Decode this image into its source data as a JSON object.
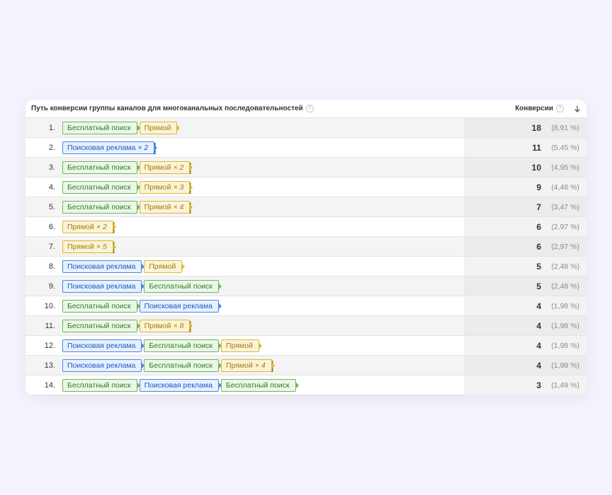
{
  "header": {
    "path_label": "Путь конверсии группы каналов для многоканальных последовательностей",
    "conversions_label": "Конверсии"
  },
  "channel_colors": {
    "Бесплатный поиск": "green",
    "Прямой": "yellow",
    "Поисковая реклама": "blue"
  },
  "rows": [
    {
      "n": 1,
      "path": [
        {
          "c": "Бесплатный поиск"
        },
        {
          "c": "Прямой"
        }
      ],
      "v": "18",
      "p": "(8,91 %)"
    },
    {
      "n": 2,
      "path": [
        {
          "c": "Поисковая реклама",
          "x": 2
        }
      ],
      "v": "11",
      "p": "(5,45 %)"
    },
    {
      "n": 3,
      "path": [
        {
          "c": "Бесплатный поиск"
        },
        {
          "c": "Прямой",
          "x": 2
        }
      ],
      "v": "10",
      "p": "(4,95 %)"
    },
    {
      "n": 4,
      "path": [
        {
          "c": "Бесплатный поиск"
        },
        {
          "c": "Прямой",
          "x": 3
        }
      ],
      "v": "9",
      "p": "(4,46 %)"
    },
    {
      "n": 5,
      "path": [
        {
          "c": "Бесплатный поиск"
        },
        {
          "c": "Прямой",
          "x": 4
        }
      ],
      "v": "7",
      "p": "(3,47 %)"
    },
    {
      "n": 6,
      "path": [
        {
          "c": "Прямой",
          "x": 2
        }
      ],
      "v": "6",
      "p": "(2,97 %)"
    },
    {
      "n": 7,
      "path": [
        {
          "c": "Прямой",
          "x": 5
        }
      ],
      "v": "6",
      "p": "(2,97 %)"
    },
    {
      "n": 8,
      "path": [
        {
          "c": "Поисковая реклама"
        },
        {
          "c": "Прямой"
        }
      ],
      "v": "5",
      "p": "(2,48 %)"
    },
    {
      "n": 9,
      "path": [
        {
          "c": "Поисковая реклама"
        },
        {
          "c": "Бесплатный поиск"
        }
      ],
      "v": "5",
      "p": "(2,48 %)"
    },
    {
      "n": 10,
      "path": [
        {
          "c": "Бесплатный поиск"
        },
        {
          "c": "Поисковая реклама"
        }
      ],
      "v": "4",
      "p": "(1,98 %)"
    },
    {
      "n": 11,
      "path": [
        {
          "c": "Бесплатный поиск"
        },
        {
          "c": "Прямой",
          "x": 8
        }
      ],
      "v": "4",
      "p": "(1,98 %)"
    },
    {
      "n": 12,
      "path": [
        {
          "c": "Поисковая реклама"
        },
        {
          "c": "Бесплатный поиск"
        },
        {
          "c": "Прямой"
        }
      ],
      "v": "4",
      "p": "(1,98 %)"
    },
    {
      "n": 13,
      "path": [
        {
          "c": "Поисковая реклама"
        },
        {
          "c": "Бесплатный поиск"
        },
        {
          "c": "Прямой",
          "x": 4
        }
      ],
      "v": "4",
      "p": "(1,98 %)"
    },
    {
      "n": 14,
      "path": [
        {
          "c": "Бесплатный поиск"
        },
        {
          "c": "Поисковая реклама"
        },
        {
          "c": "Бесплатный поиск"
        }
      ],
      "v": "3",
      "p": "(1,49 %)"
    }
  ]
}
